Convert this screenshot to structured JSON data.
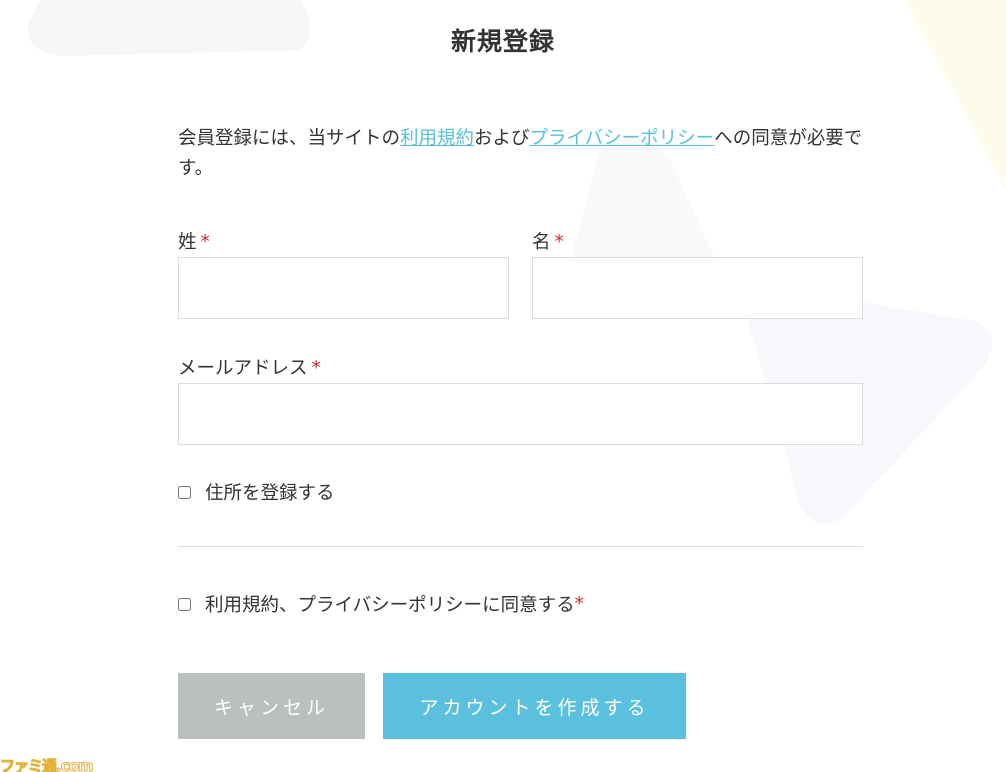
{
  "page": {
    "title": "新規登録"
  },
  "intro": {
    "before": "会員登録には、当サイトの",
    "terms_link": "利用規約",
    "middle": "および",
    "privacy_link": "プライバシーポリシー",
    "after": "への同意が必要です。"
  },
  "fields": {
    "last_name": {
      "label": "姓",
      "required_mark": "*",
      "value": ""
    },
    "first_name": {
      "label": "名",
      "required_mark": "*",
      "value": ""
    },
    "email": {
      "label": "メールアドレス",
      "required_mark": "*",
      "value": ""
    }
  },
  "checkboxes": {
    "register_address": {
      "label": "住所を登録する",
      "checked": false
    },
    "agree_terms": {
      "label": "利用規約、プライバシーポリシーに同意する",
      "required_mark": "*",
      "checked": false
    }
  },
  "buttons": {
    "cancel": "キャンセル",
    "create": "アカウントを作成する"
  },
  "watermark": "ファミ通.com",
  "colors": {
    "accent": "#5bc0de",
    "cancel_button": "#b9c0be",
    "required": "#d9292a",
    "input_border": "#dcdcdc"
  }
}
